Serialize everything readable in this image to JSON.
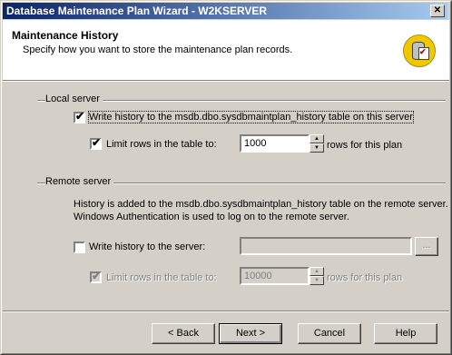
{
  "window": {
    "title": "Database Maintenance Plan Wizard - W2KSERVER",
    "close_glyph": "✕"
  },
  "header": {
    "title": "Maintenance History",
    "subtitle": "Specify how you want to store the maintenance plan records."
  },
  "local": {
    "group_label": "Local server",
    "write_history": {
      "label": "Write history to the msdb.dbo.sysdbmaintplan_history table on this server",
      "checked": true
    },
    "limit_rows": {
      "label": "Limit rows in the table to:",
      "checked": true,
      "value": "1000",
      "suffix": "rows for this plan"
    }
  },
  "remote": {
    "group_label": "Remote server",
    "info_line1": "History is added to the msdb.dbo.sysdbmaintplan_history table on the remote server.",
    "info_line2": "Windows Authentication is used to log on to the remote server.",
    "write_history": {
      "label": "Write history to the server:",
      "checked": false,
      "server_value": ""
    },
    "browse_label": "...",
    "limit_rows": {
      "label": "Limit rows in the table to:",
      "checked": true,
      "value": "10000",
      "suffix": "rows for this plan"
    }
  },
  "footer": {
    "back": "< Back",
    "next": "Next >",
    "cancel": "Cancel",
    "help": "Help"
  },
  "icons": {
    "checkbox_mark": "✔",
    "spin_up": "▲",
    "spin_down": "▼"
  }
}
